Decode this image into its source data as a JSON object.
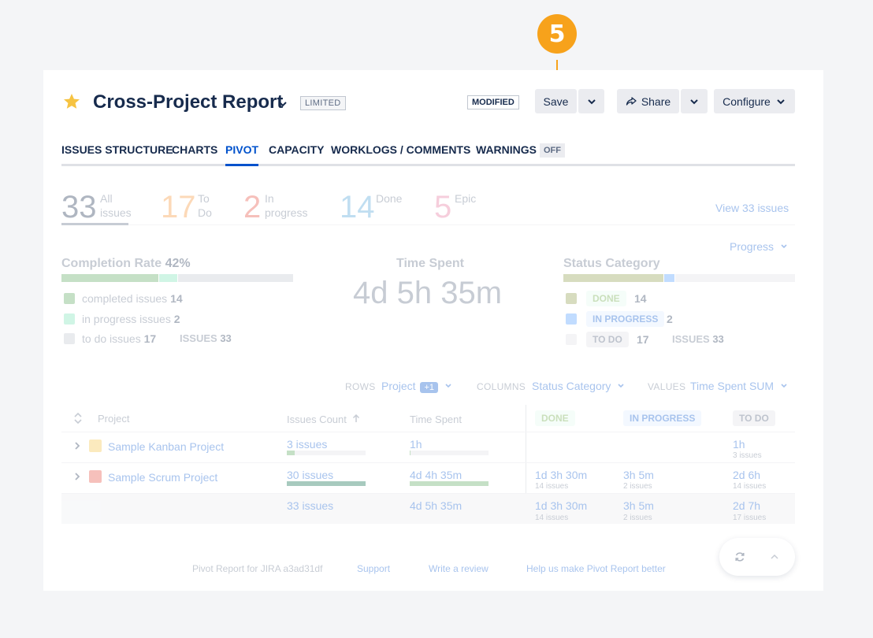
{
  "callout": {
    "number": "5",
    "color": "#f7a21b"
  },
  "header": {
    "title": "Cross-Project Report",
    "limited_badge": "LIMITED",
    "modified_badge": "MODIFIED",
    "save_label": "Save",
    "share_label": "Share",
    "configure_label": "Configure"
  },
  "tabs": [
    {
      "label": "ISSUES STRUCTURE"
    },
    {
      "label": "CHARTS"
    },
    {
      "label": "PIVOT",
      "active": true
    },
    {
      "label": "CAPACITY"
    },
    {
      "label": "WORKLOGS / COMMENTS"
    },
    {
      "label": "WARNINGS",
      "badge": "OFF"
    }
  ],
  "stats": {
    "items": [
      {
        "value": "33",
        "label1": "All",
        "label2": "issues",
        "color": "#172b4d"
      },
      {
        "value": "17",
        "label1": "To",
        "label2": "Do",
        "color": "#f79232"
      },
      {
        "value": "2",
        "label1": "In",
        "label2": "progress",
        "color": "#e5493a"
      },
      {
        "value": "14",
        "label1": "Done",
        "label2": "",
        "color": "#4a9fd8"
      },
      {
        "value": "5",
        "label1": "Epic",
        "label2": "",
        "color": "#e5739a"
      }
    ],
    "view_link": "View 33 issues"
  },
  "progress_dropdown": "Progress",
  "completion": {
    "title": "Completion Rate",
    "percent": "42%",
    "completed_label": "completed issues",
    "completed_value": "14",
    "in_progress_label": "in progress issues",
    "in_progress_value": "2",
    "todo_label": "to do issues",
    "todo_value": "17",
    "issues_label": "ISSUES",
    "issues_value": "33"
  },
  "time_spent": {
    "title": "Time Spent",
    "value": "4d 5h 35m"
  },
  "status_category": {
    "title": "Status Category",
    "done_label": "DONE",
    "done_value": "14",
    "in_progress_label": "IN PROGRESS",
    "in_progress_value": "2",
    "todo_label": "TO DO",
    "todo_value": "17",
    "issues_label": "ISSUES",
    "issues_value": "33"
  },
  "controls": {
    "rows_label": "ROWS",
    "rows_value": "Project",
    "rows_extra": "+1",
    "columns_label": "COLUMNS",
    "columns_value": "Status Category",
    "values_label": "VALUES",
    "values_value": "Time Spent SUM"
  },
  "table": {
    "headers": {
      "project": "Project",
      "issues_count": "Issues Count",
      "time_spent": "Time Spent",
      "done": "DONE",
      "in_progress": "IN PROGRESS",
      "todo": "TO DO"
    },
    "rows": [
      {
        "project": "Sample Kanban Project",
        "issues": "3 issues",
        "time": "1h",
        "done": "",
        "done_sub": "",
        "in_progress": "",
        "in_progress_sub": "",
        "todo": "1h",
        "todo_sub": "3 issues"
      },
      {
        "project": "Sample Scrum Project",
        "issues": "30 issues",
        "time": "4d 4h 35m",
        "done": "1d 3h 30m",
        "done_sub": "14 issues",
        "in_progress": "3h 5m",
        "in_progress_sub": "2 issues",
        "todo": "2d 6h",
        "todo_sub": "14 issues"
      }
    ],
    "totals": {
      "issues": "33 issues",
      "time": "4d 5h 35m",
      "done": "1d 3h 30m",
      "done_sub": "14 issues",
      "in_progress": "3h 5m",
      "in_progress_sub": "2 issues",
      "todo": "2d 7h",
      "todo_sub": "17 issues"
    }
  },
  "footer": {
    "version": "Pivot Report for JIRA a3ad31df",
    "support": "Support",
    "review": "Write a review",
    "improve": "Help us make Pivot Report better"
  }
}
